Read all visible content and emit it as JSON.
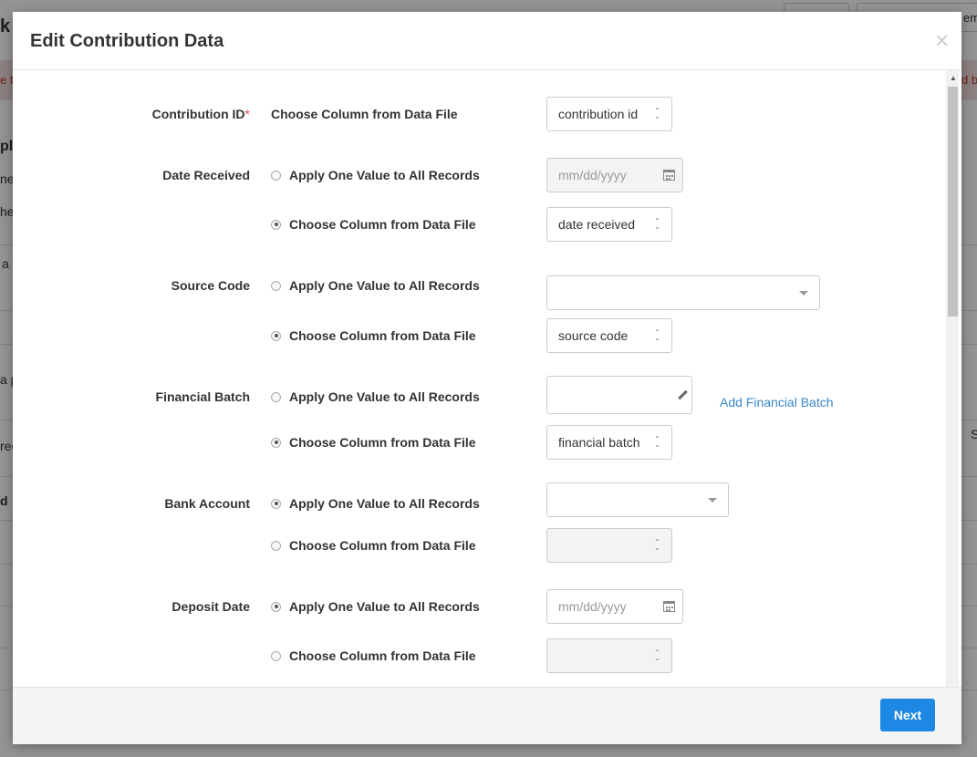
{
  "background": {
    "fragments": [
      "k",
      "e t",
      "pl",
      "nev",
      "he",
      "a",
      "a p",
      "rec",
      "d",
      "d b",
      "em",
      "S"
    ]
  },
  "modal": {
    "title": "Edit Contribution Data",
    "close_symbol": "×",
    "fields": {
      "contribution_id": {
        "label": "Contribution ID",
        "required_mark": "*",
        "option_text": "Choose Column from Data File",
        "select_value": "contribution id"
      },
      "date_received": {
        "label": "Date Received",
        "apply_label": "Apply One Value to All Records",
        "apply_selected": false,
        "date_placeholder": "mm/dd/yyyy",
        "choose_label": "Choose Column from Data File",
        "choose_selected": true,
        "select_value": "date received"
      },
      "source_code": {
        "label": "Source Code",
        "apply_label": "Apply One Value to All Records",
        "apply_selected": false,
        "dropdown_value": "",
        "choose_label": "Choose Column from Data File",
        "choose_selected": true,
        "select_value": "source code"
      },
      "financial_batch": {
        "label": "Financial Batch",
        "apply_label": "Apply One Value to All Records",
        "apply_selected": false,
        "input_value": "",
        "add_link": "Add Financial Batch",
        "choose_label": "Choose Column from Data File",
        "choose_selected": true,
        "select_value": "financial batch"
      },
      "bank_account": {
        "label": "Bank Account",
        "apply_label": "Apply One Value to All Records",
        "apply_selected": true,
        "dropdown_value": "",
        "choose_label": "Choose Column from Data File",
        "choose_selected": false,
        "select_value": ""
      },
      "deposit_date": {
        "label": "Deposit Date",
        "apply_label": "Apply One Value to All Records",
        "apply_selected": true,
        "date_placeholder": "mm/dd/yyyy",
        "choose_label": "Choose Column from Data File",
        "choose_selected": false,
        "select_value": ""
      }
    },
    "footer": {
      "next_label": "Next"
    }
  },
  "colors": {
    "primary": "#1e88e5",
    "link": "#3a87c8",
    "required": "#d9534f"
  }
}
